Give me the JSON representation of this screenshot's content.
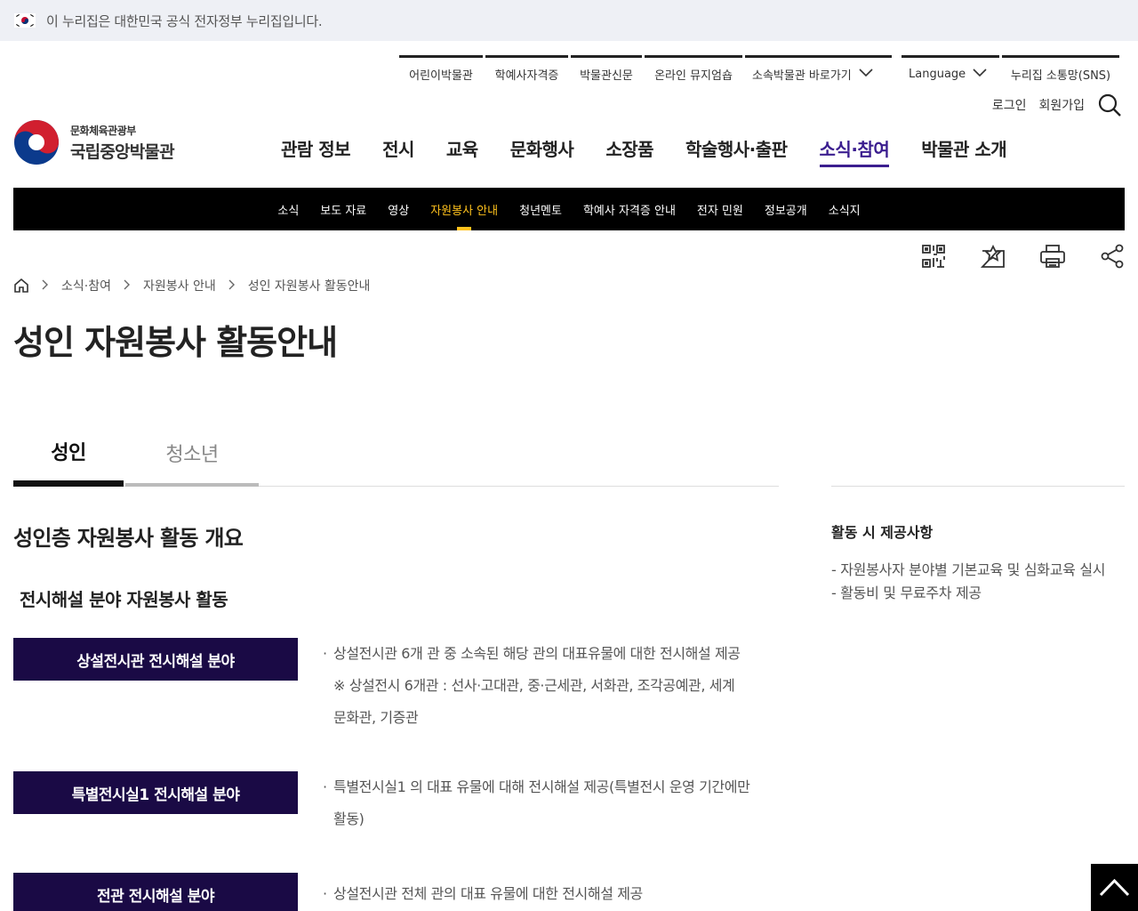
{
  "gov_banner": {
    "text": "이 누리집은 대한민국 공식 전자정부 누리집입니다."
  },
  "utility_links": [
    "어린이박물관",
    "학예사자격증",
    "박물관신문",
    "온라인 뮤지엄숍",
    "소속박물관 바로가기",
    "Language",
    "누리집 소통망(SNS)"
  ],
  "account": {
    "login": "로그인",
    "signup": "회원가입"
  },
  "logo": {
    "ministry": "문화체육관광부",
    "name": "국립중앙박물관"
  },
  "main_nav": [
    "관람 정보",
    "전시",
    "교육",
    "문화행사",
    "소장품",
    "학술행사·출판",
    "소식·참여",
    "박물관 소개"
  ],
  "sub_nav": [
    "소식",
    "보도 자료",
    "영상",
    "자원봉사 안내",
    "청년멘토",
    "학예사 자격증 안내",
    "전자 민원",
    "정보공개",
    "소식지"
  ],
  "breadcrumb": [
    "소식·참여",
    "자원봉사 안내",
    "성인 자원봉사 활동안내"
  ],
  "page_title": "성인 자원봉사 활동안내",
  "tabs": [
    "성인",
    "청소년"
  ],
  "section_title": "성인층 자원봉사 활동 개요",
  "subsection_title": "전시해설 분야 자원봉사 활동",
  "categories": [
    {
      "label": "상설전시관 전시해설 분야",
      "desc": "상설전시관 6개 관 중 소속된 해당 관의 대표유물에 대한 전시해설 제공",
      "note_line1": "※ 상설전시 6개관 : 선사·고대관, 중·근세관, 서화관, 조각공예관, 세계",
      "note_line2": "문화관, 기증관"
    },
    {
      "label": "특별전시실1 전시해설 분야",
      "desc_line1": "특별전시실1 의 대표 유물에 대해 전시해설 제공(특별전시 운영 기간에만",
      "desc_line2": "활동)"
    },
    {
      "label": "전관 전시해설 분야",
      "desc": "상설전시관 전체 관의 대표 유물에 대한 전시해설 제공"
    }
  ],
  "sidebar": {
    "title": "활동 시 제공사항",
    "items": [
      "- 자원봉사자 분야별 기본교육 및 심화교육 실시",
      "- 활동비 및 무료주차 제공"
    ]
  },
  "colors": {
    "accent": "#3b1e8f",
    "category_bg": "#1a0a45",
    "subnav_active": "#ffc21d"
  },
  "icons": [
    "korea-flag-icon",
    "chevron-down-icon",
    "search-icon",
    "qr-code-icon",
    "bookmark-star-icon",
    "print-icon",
    "share-icon",
    "home-icon",
    "chevron-up-icon"
  ]
}
